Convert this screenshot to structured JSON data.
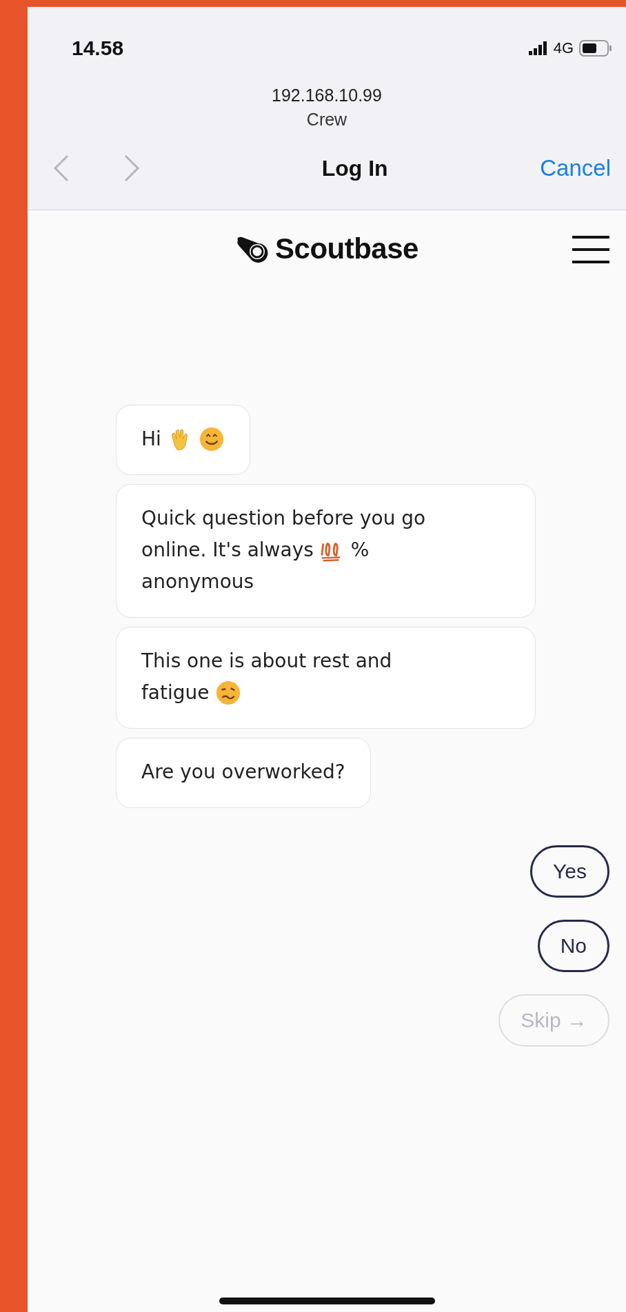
{
  "status_bar": {
    "time": "14.58",
    "network": "4G"
  },
  "browser": {
    "address": "192.168.10.99",
    "site": "Crew",
    "title": "Log In",
    "cancel": "Cancel"
  },
  "header": {
    "logo": "Scoutbase"
  },
  "messages": [
    {
      "lines": [
        [
          {
            "kind": "text",
            "text": "Hi"
          },
          {
            "kind": "wave"
          },
          {
            "kind": "smile"
          }
        ]
      ]
    },
    {
      "lines": [
        [
          {
            "kind": "text",
            "text": "Quick question before you go"
          }
        ],
        [
          {
            "kind": "text",
            "text": "online. It's always"
          },
          {
            "kind": "hundred"
          },
          {
            "kind": "text",
            "text": "%"
          }
        ],
        [
          {
            "kind": "text",
            "text": "anonymous"
          }
        ]
      ]
    },
    {
      "lines": [
        [
          {
            "kind": "text",
            "text": "This one is about rest and"
          }
        ],
        [
          {
            "kind": "text",
            "text": "fatigue"
          },
          {
            "kind": "woozy"
          }
        ]
      ]
    },
    {
      "lines": [
        [
          {
            "kind": "text",
            "text": "Are you overworked?"
          }
        ]
      ]
    }
  ],
  "answers": [
    {
      "label": "Yes",
      "disabled": false
    },
    {
      "label": "No",
      "disabled": false
    },
    {
      "label": "Skip →",
      "disabled": true
    }
  ]
}
